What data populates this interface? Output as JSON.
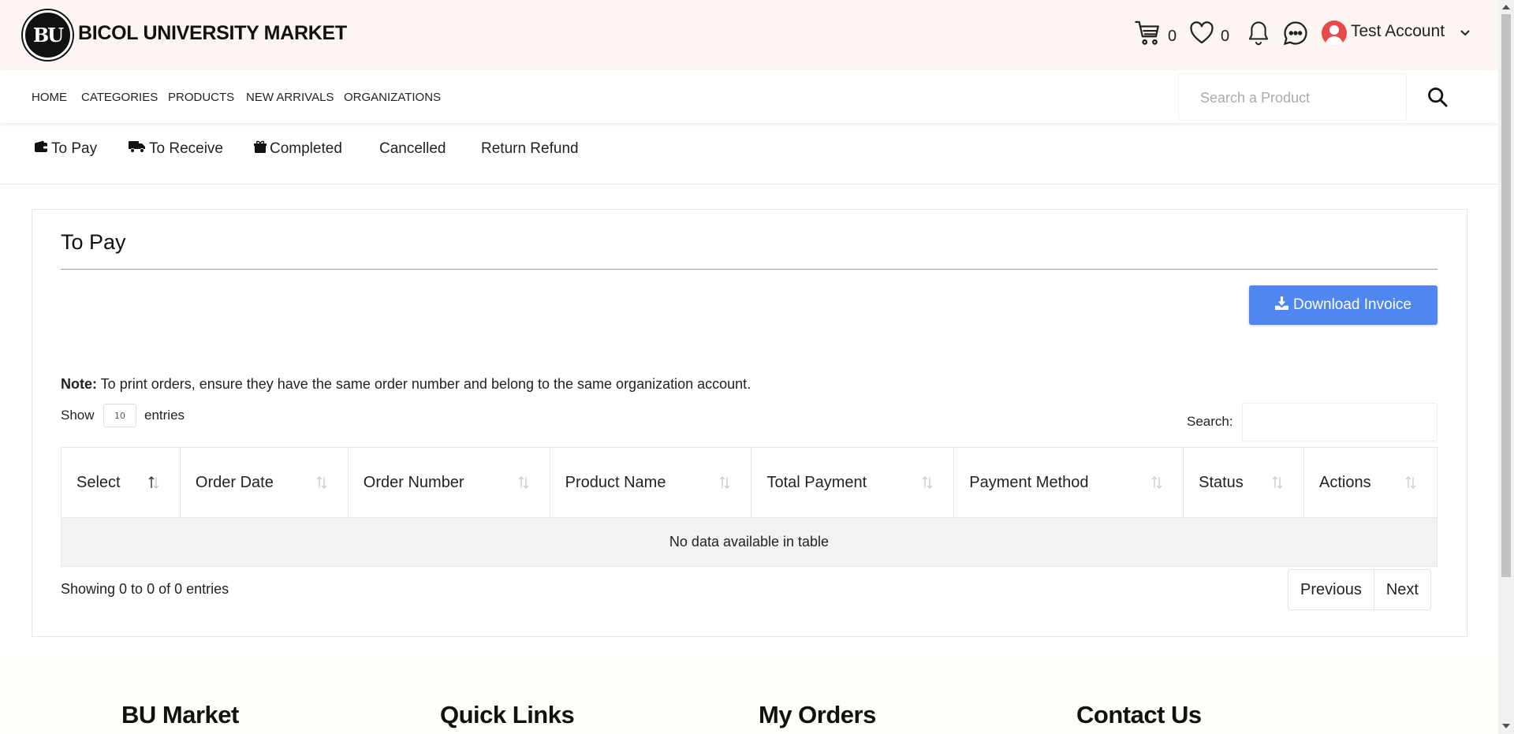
{
  "header": {
    "brand": "BICOL UNIVERSITY MARKET",
    "logo_text": "BU",
    "cart_count": "0",
    "wishlist_count": "0",
    "account_name": "Test Account"
  },
  "nav": {
    "items": [
      "HOME",
      "CATEGORIES",
      "PRODUCTS",
      "NEW ARRIVALS",
      "ORGANIZATIONS"
    ],
    "search_placeholder": "Search a Product"
  },
  "tabs": [
    "To Pay",
    "To Receive",
    "Completed",
    "Cancelled",
    "Return Refund"
  ],
  "card": {
    "title": "To Pay",
    "download_label": "Download Invoice",
    "note_bold": "Note:",
    "note_text": " To print orders, ensure they have the same order number and belong to the same organization account.",
    "show_label": "Show",
    "entries_label": "entries",
    "length_value": "10",
    "search_label": "Search:",
    "columns": [
      "Select",
      "Order Date",
      "Order Number",
      "Product Name",
      "Total Payment",
      "Payment Method",
      "Status",
      "Actions"
    ],
    "empty_text": "No data available in table",
    "info_text": "Showing 0 to 0 of 0 entries",
    "prev_label": "Previous",
    "next_label": "Next"
  },
  "footer": {
    "headings": [
      "BU Market",
      "Quick Links",
      "My Orders",
      "Contact Us"
    ]
  },
  "colors": {
    "accent": "#4f86f0",
    "header_bg": "#fcf5f2",
    "avatar": "#e84a4a"
  }
}
